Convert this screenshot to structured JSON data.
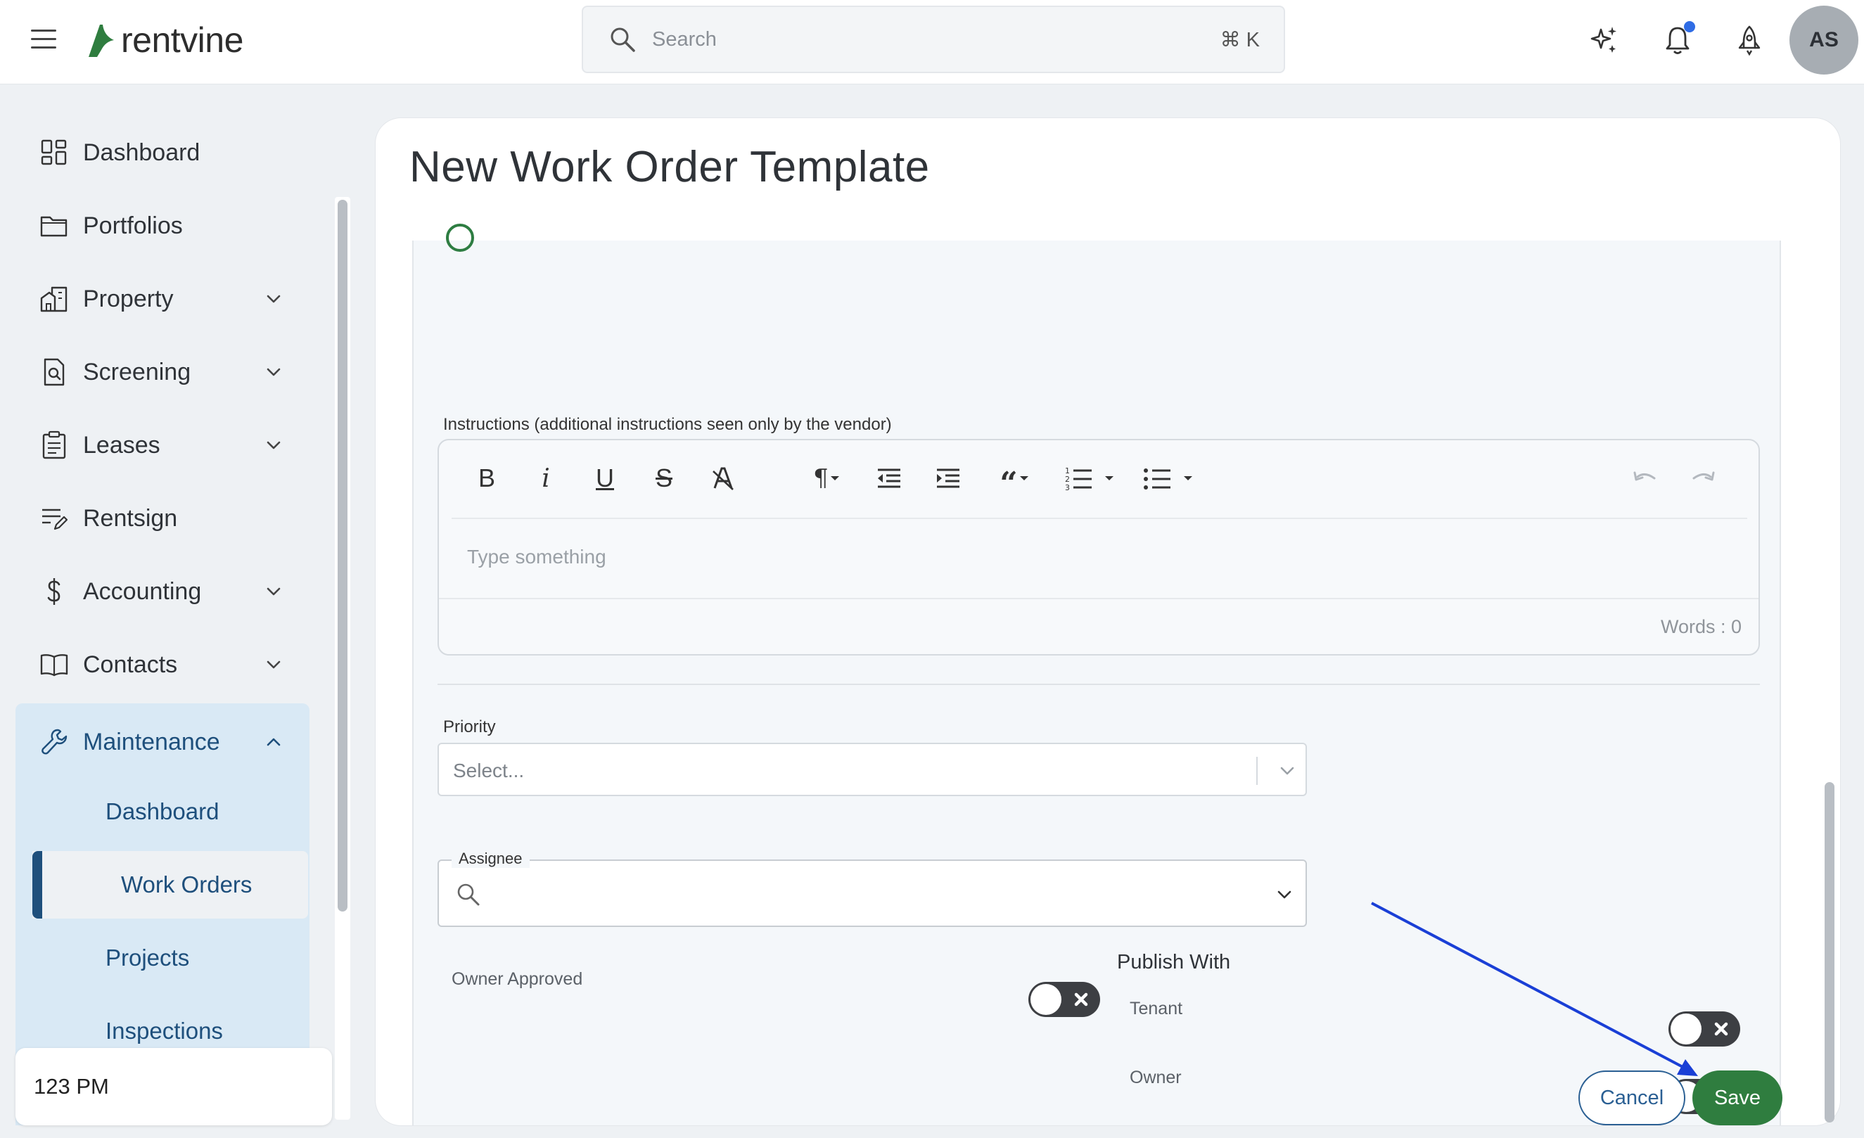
{
  "app": {
    "logo_text": "rentvine"
  },
  "search": {
    "placeholder": "Search",
    "shortcut": "⌘ K"
  },
  "user": {
    "initials": "AS"
  },
  "sidebar": {
    "items": [
      {
        "label": "Dashboard",
        "icon": "dashboard-icon"
      },
      {
        "label": "Portfolios",
        "icon": "folder-icon"
      },
      {
        "label": "Property",
        "icon": "buildings-icon"
      },
      {
        "label": "Screening",
        "icon": "document-search-icon"
      },
      {
        "label": "Leases",
        "icon": "clipboard-icon"
      },
      {
        "label": "Rentsign",
        "icon": "pen-lines-icon"
      },
      {
        "label": "Accounting",
        "icon": "dollar-icon"
      },
      {
        "label": "Contacts",
        "icon": "book-icon"
      }
    ],
    "maintenance": {
      "label": "Maintenance",
      "icon": "wrench-icon",
      "sub_items": [
        "Dashboard",
        "Work Orders",
        "Projects",
        "Inspections"
      ],
      "active": "Work Orders"
    },
    "time_text": "123 PM"
  },
  "page": {
    "title": "New Work Order Template"
  },
  "form": {
    "instructions_label": "Instructions (additional instructions seen only by the vendor)",
    "editor_placeholder": "Type something",
    "word_count": "Words : 0",
    "priority_label": "Priority",
    "priority_placeholder": "Select...",
    "assignee_label": "Assignee",
    "owner_approved_label": "Owner Approved",
    "publish_with_label": "Publish With",
    "tenant_label": "Tenant",
    "owner_label": "Owner"
  },
  "actions": {
    "cancel_label": "Cancel",
    "save_label": "Save"
  },
  "colors": {
    "brand_green": "#2f7d3f",
    "accent_blue": "#1e4f7c",
    "sidebar_active_bg": "#d9e9f5",
    "annotation_arrow": "#1a3fd6"
  }
}
